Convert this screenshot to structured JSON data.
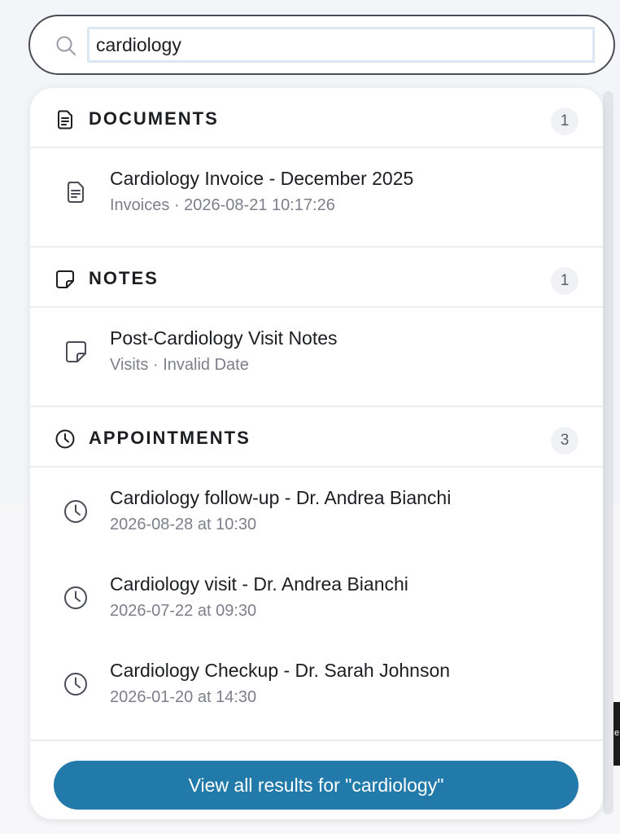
{
  "search": {
    "query": "cardiology"
  },
  "sections": {
    "documents": {
      "title": "DOCUMENTS",
      "count": "1",
      "items": [
        {
          "title": "Cardiology Invoice - December 2025",
          "subtitle": "Invoices · 2026-08-21 10:17:26"
        }
      ]
    },
    "notes": {
      "title": "NOTES",
      "count": "1",
      "items": [
        {
          "title": "Post-Cardiology Visit Notes",
          "subtitle": "Visits · Invalid Date"
        }
      ]
    },
    "appointments": {
      "title": "APPOINTMENTS",
      "count": "3",
      "items": [
        {
          "title": "Cardiology follow-up - Dr. Andrea Bianchi",
          "subtitle": "2026-08-28 at 10:30"
        },
        {
          "title": "Cardiology visit - Dr. Andrea Bianchi",
          "subtitle": "2026-07-22 at 09:30"
        },
        {
          "title": "Cardiology Checkup - Dr. Sarah Johnson",
          "subtitle": "2026-01-20 at 14:30"
        }
      ]
    }
  },
  "footer": {
    "view_all_label": "View all results for \"cardiology\""
  },
  "colors": {
    "accent": "#217aa9",
    "border": "#4a4d55",
    "muted_text": "#7d808a"
  },
  "icons": {
    "search": "search-icon",
    "document": "document-icon",
    "note": "note-icon",
    "clock": "clock-icon"
  }
}
